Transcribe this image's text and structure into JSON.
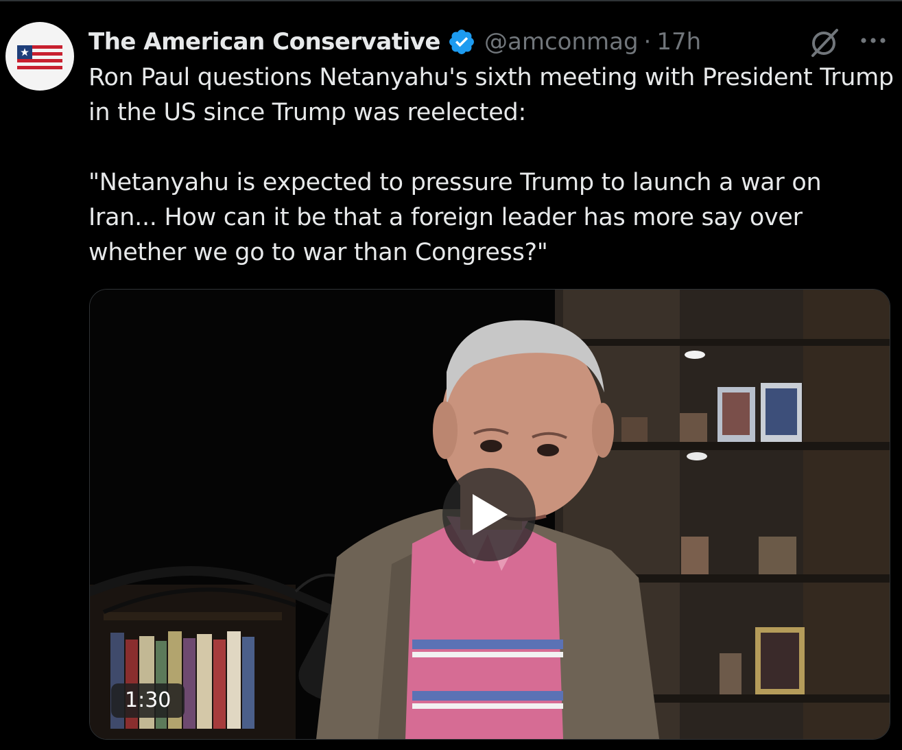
{
  "tweet": {
    "author": {
      "display_name": "The American Conservative",
      "handle": "@amconmag",
      "separator": "·",
      "time": "17h",
      "verified_color": "#1d9bf0"
    },
    "text": "Ron Paul questions Netanyahu's sixth meeting with President Trump in the US since Trump was reelected:\n\n\"Netanyahu is expected to pressure Trump to launch a war on Iran... How can it be that a foreign leader has more say over whether we go to war than Congress?\"",
    "icons": {
      "avatar": "flag-logo-icon",
      "verified": "verified-badge-icon",
      "grok": "grok-icon",
      "more": "more-options-icon"
    },
    "media": {
      "type": "video",
      "duration": "1:30",
      "play_icon": "play-icon"
    }
  }
}
